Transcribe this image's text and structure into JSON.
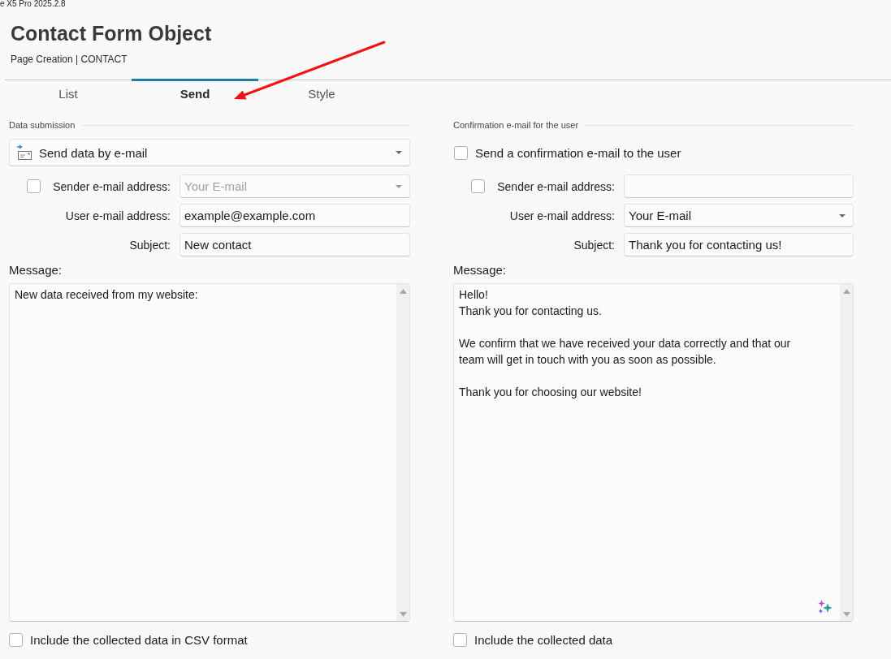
{
  "window": {
    "title": "e X5 Pro 2025.2.8"
  },
  "header": {
    "title": "Contact Form Object",
    "breadcrumb": "Page Creation | CONTACT"
  },
  "tabs": [
    {
      "label": "List",
      "selected": false
    },
    {
      "label": "Send",
      "selected": true
    },
    {
      "label": "Style",
      "selected": false
    }
  ],
  "data_submission": {
    "heading": "Data submission",
    "method": {
      "value": "Send data by e-mail"
    },
    "fields": [
      {
        "kind": "dropdown",
        "label": "Sender e-mail address:",
        "checked": false,
        "placeholder": "Your E-mail"
      },
      {
        "kind": "text",
        "label": "User e-mail address:",
        "value": "example@example.com"
      },
      {
        "kind": "text",
        "label": "Subject:",
        "value": "New contact"
      }
    ],
    "message": {
      "label": "Message:",
      "value": "New data received from my website:"
    },
    "attachment_option": {
      "label": "Include the collected data in CSV format",
      "checked": false
    }
  },
  "confirmation_email": {
    "heading": "Confirmation e-mail for the user",
    "enable_option": {
      "label": "Send a confirmation e-mail to the user",
      "checked": false
    },
    "fields": [
      {
        "kind": "text",
        "label": "Sender e-mail address:",
        "checked": false
      },
      {
        "kind": "dropdown",
        "label": "User e-mail address:",
        "value": "Your E-mail"
      },
      {
        "kind": "text",
        "label": "Subject:",
        "value": "Thank you for contacting us!"
      }
    ],
    "message": {
      "label": "Message:",
      "value": "Hello!\nThank you for contacting us.\n\nWe confirm that we have received your data correctly and that our\nteam will get in touch with you as soon as possible.\n\nThank you for choosing our website!"
    },
    "attachment_option": {
      "label": "Include the collected data",
      "checked": false
    }
  }
}
